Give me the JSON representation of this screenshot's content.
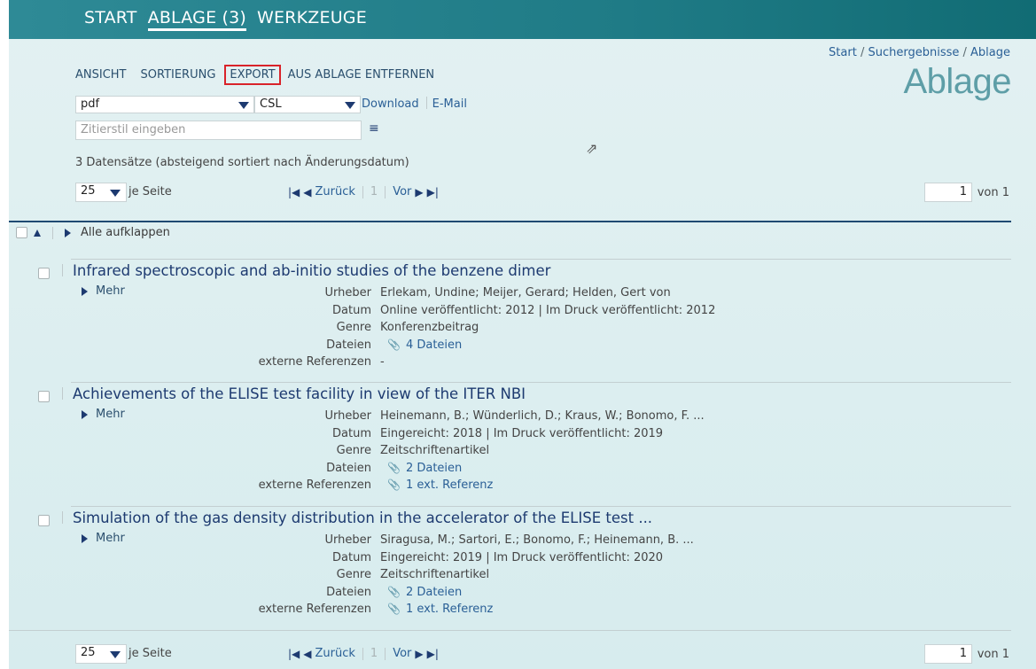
{
  "topnav": {
    "items": [
      "START",
      "ABLAGE (3)",
      "WERKZEUGE"
    ]
  },
  "breadcrumb": {
    "start": "Start",
    "results": "Suchergebnisse",
    "current": "Ablage",
    "sep": " / "
  },
  "page_title": "Ablage",
  "menu": {
    "view": "ANSICHT",
    "sort": "SORTIERUNG",
    "export": "EXPORT",
    "remove": "AUS ABLAGE ENTFERNEN"
  },
  "export": {
    "format_value": "pdf",
    "style_value": "CSL",
    "download": "Download",
    "email": "E-Mail",
    "cite_placeholder": "Zitierstil eingeben"
  },
  "count_text": "3 Datensätze (absteigend sortiert nach Änderungsdatum)",
  "pager": {
    "per_page": "25",
    "per_page_label": "je Seite",
    "back": "Zurück",
    "current": "1",
    "next": "Vor",
    "page_input": "1",
    "of": "von 1"
  },
  "expand_all": "Alle aufklappen",
  "more_label": "Mehr",
  "labels": {
    "creators": "Urheber",
    "date": "Datum",
    "genre": "Genre",
    "files": "Dateien",
    "extrefs": "externe Referenzen"
  },
  "items": [
    {
      "title": "Infrared spectroscopic and ab-initio studies of the benzene dimer",
      "creators": "Erlekam, Undine; Meijer, Gerard; Helden, Gert von",
      "date": "Online veröffentlicht: 2012 | Im Druck veröffentlicht: 2012",
      "genre": "Konferenzbeitrag",
      "files": "4 Dateien",
      "extrefs": "-"
    },
    {
      "title": "Achievements of the ELISE test facility in view of the ITER NBI",
      "creators": "Heinemann, B.; Wünderlich, D.; Kraus, W.; Bonomo, F. ...",
      "date": "Eingereicht: 2018 | Im Druck veröffentlicht: 2019",
      "genre": "Zeitschriftenartikel",
      "files": "2 Dateien",
      "extrefs": "1 ext. Referenz"
    },
    {
      "title": "Simulation of the gas density distribution in the accelerator of the ELISE test ...",
      "creators": "Siragusa, M.; Sartori, E.; Bonomo, F.; Heinemann, B. ...",
      "date": "Eingereicht: 2019 | Im Druck veröffentlicht: 2020",
      "genre": "Zeitschriftenartikel",
      "files": "2 Dateien",
      "extrefs": "1 ext. Referenz"
    }
  ],
  "icons": {
    "dropdown": "triangle-down",
    "list": "list-icon",
    "paperclip": "paperclip-icon",
    "cursor": "mouse-pointer"
  },
  "colors": {
    "topbar": "#1f7b86",
    "accent_red": "#d9232a",
    "link": "#2a5f96",
    "title": "#1d3a70",
    "background": "#dcedef"
  }
}
